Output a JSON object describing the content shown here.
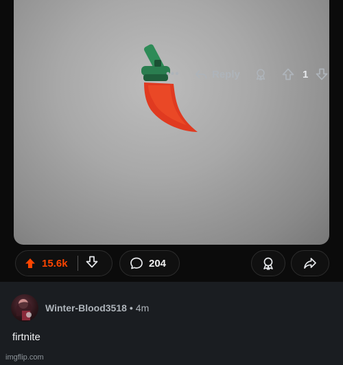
{
  "post": {
    "upvotes": "15.6k",
    "comments": "204"
  },
  "comment": {
    "username": "Winter-Blood3518",
    "separator": "•",
    "time": "4m",
    "text": "firtnite",
    "more": "•••",
    "reply_label": "Reply",
    "score": "1"
  },
  "watermark": "imgflip.com",
  "colors": {
    "upvote_accent": "#ff4500",
    "comment_bg": "#1a1d21",
    "page_bg": "#0b0b0b"
  }
}
